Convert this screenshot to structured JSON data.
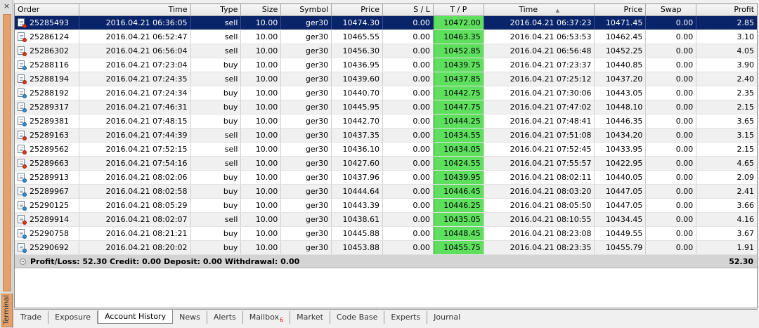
{
  "window": {
    "sidebar_label": "Terminal",
    "close_glyph": "×"
  },
  "columns": {
    "order": "Order",
    "time": "Time",
    "type": "Type",
    "size": "Size",
    "symbol": "Symbol",
    "price": "Price",
    "sl": "S / L",
    "tp": "T / P",
    "close_time": "Time",
    "sort_indicator": "▲",
    "close_price": "Price",
    "swap": "Swap",
    "profit": "Profit"
  },
  "colors": {
    "sell_dot": "#d9391c",
    "buy_dot": "#2d8fd9",
    "tp_highlight": "#5ee05e",
    "selected_row": "#0a246a"
  },
  "rows": [
    {
      "order": "25285493",
      "time": "2016.04.21 06:36:05",
      "type": "sell",
      "size": "10.00",
      "symbol": "ger30",
      "price": "10474.30",
      "sl": "0.00",
      "tp": "10472.00",
      "close_time": "2016.04.21 06:37:23",
      "close_price": "10471.45",
      "swap": "0.00",
      "profit": "2.85"
    },
    {
      "order": "25286124",
      "time": "2016.04.21 06:52:47",
      "type": "sell",
      "size": "10.00",
      "symbol": "ger30",
      "price": "10465.55",
      "sl": "0.00",
      "tp": "10463.35",
      "close_time": "2016.04.21 06:53:53",
      "close_price": "10462.45",
      "swap": "0.00",
      "profit": "3.10"
    },
    {
      "order": "25286302",
      "time": "2016.04.21 06:56:04",
      "type": "sell",
      "size": "10.00",
      "symbol": "ger30",
      "price": "10456.30",
      "sl": "0.00",
      "tp": "10452.85",
      "close_time": "2016.04.21 06:56:48",
      "close_price": "10452.25",
      "swap": "0.00",
      "profit": "4.05"
    },
    {
      "order": "25288116",
      "time": "2016.04.21 07:23:04",
      "type": "buy",
      "size": "10.00",
      "symbol": "ger30",
      "price": "10436.95",
      "sl": "0.00",
      "tp": "10439.75",
      "close_time": "2016.04.21 07:23:37",
      "close_price": "10440.85",
      "swap": "0.00",
      "profit": "3.90"
    },
    {
      "order": "25288194",
      "time": "2016.04.21 07:24:35",
      "type": "sell",
      "size": "10.00",
      "symbol": "ger30",
      "price": "10439.60",
      "sl": "0.00",
      "tp": "10437.85",
      "close_time": "2016.04.21 07:25:12",
      "close_price": "10437.20",
      "swap": "0.00",
      "profit": "2.40"
    },
    {
      "order": "25288192",
      "time": "2016.04.21 07:24:34",
      "type": "buy",
      "size": "10.00",
      "symbol": "ger30",
      "price": "10440.70",
      "sl": "0.00",
      "tp": "10442.75",
      "close_time": "2016.04.21 07:30:06",
      "close_price": "10443.05",
      "swap": "0.00",
      "profit": "2.35"
    },
    {
      "order": "25289317",
      "time": "2016.04.21 07:46:31",
      "type": "buy",
      "size": "10.00",
      "symbol": "ger30",
      "price": "10445.95",
      "sl": "0.00",
      "tp": "10447.75",
      "close_time": "2016.04.21 07:47:02",
      "close_price": "10448.10",
      "swap": "0.00",
      "profit": "2.15"
    },
    {
      "order": "25289381",
      "time": "2016.04.21 07:48:15",
      "type": "buy",
      "size": "10.00",
      "symbol": "ger30",
      "price": "10442.70",
      "sl": "0.00",
      "tp": "10444.25",
      "close_time": "2016.04.21 07:48:41",
      "close_price": "10446.35",
      "swap": "0.00",
      "profit": "3.65"
    },
    {
      "order": "25289163",
      "time": "2016.04.21 07:44:39",
      "type": "sell",
      "size": "10.00",
      "symbol": "ger30",
      "price": "10437.35",
      "sl": "0.00",
      "tp": "10434.55",
      "close_time": "2016.04.21 07:51:08",
      "close_price": "10434.20",
      "swap": "0.00",
      "profit": "3.15"
    },
    {
      "order": "25289562",
      "time": "2016.04.21 07:52:15",
      "type": "sell",
      "size": "10.00",
      "symbol": "ger30",
      "price": "10436.10",
      "sl": "0.00",
      "tp": "10434.05",
      "close_time": "2016.04.21 07:52:45",
      "close_price": "10433.95",
      "swap": "0.00",
      "profit": "2.15"
    },
    {
      "order": "25289663",
      "time": "2016.04.21 07:54:16",
      "type": "sell",
      "size": "10.00",
      "symbol": "ger30",
      "price": "10427.60",
      "sl": "0.00",
      "tp": "10424.55",
      "close_time": "2016.04.21 07:55:57",
      "close_price": "10422.95",
      "swap": "0.00",
      "profit": "4.65"
    },
    {
      "order": "25289913",
      "time": "2016.04.21 08:02:06",
      "type": "buy",
      "size": "10.00",
      "symbol": "ger30",
      "price": "10437.96",
      "sl": "0.00",
      "tp": "10439.95",
      "close_time": "2016.04.21 08:02:11",
      "close_price": "10440.05",
      "swap": "0.00",
      "profit": "2.09"
    },
    {
      "order": "25289967",
      "time": "2016.04.21 08:02:58",
      "type": "buy",
      "size": "10.00",
      "symbol": "ger30",
      "price": "10444.64",
      "sl": "0.00",
      "tp": "10446.45",
      "close_time": "2016.04.21 08:03:20",
      "close_price": "10447.05",
      "swap": "0.00",
      "profit": "2.41"
    },
    {
      "order": "25290125",
      "time": "2016.04.21 08:05:29",
      "type": "buy",
      "size": "10.00",
      "symbol": "ger30",
      "price": "10443.39",
      "sl": "0.00",
      "tp": "10446.25",
      "close_time": "2016.04.21 08:05:50",
      "close_price": "10447.05",
      "swap": "0.00",
      "profit": "3.66"
    },
    {
      "order": "25289914",
      "time": "2016.04.21 08:02:07",
      "type": "sell",
      "size": "10.00",
      "symbol": "ger30",
      "price": "10438.61",
      "sl": "0.00",
      "tp": "10435.05",
      "close_time": "2016.04.21 08:10:55",
      "close_price": "10434.45",
      "swap": "0.00",
      "profit": "4.16"
    },
    {
      "order": "25290758",
      "time": "2016.04.21 08:21:21",
      "type": "buy",
      "size": "10.00",
      "symbol": "ger30",
      "price": "10445.88",
      "sl": "0.00",
      "tp": "10448.45",
      "close_time": "2016.04.21 08:23:08",
      "close_price": "10449.55",
      "swap": "0.00",
      "profit": "3.67"
    },
    {
      "order": "25290692",
      "time": "2016.04.21 08:20:02",
      "type": "buy",
      "size": "10.00",
      "symbol": "ger30",
      "price": "10453.88",
      "sl": "0.00",
      "tp": "10455.75",
      "close_time": "2016.04.21 08:23:35",
      "close_price": "10455.79",
      "swap": "0.00",
      "profit": "1.91"
    }
  ],
  "summary": {
    "text": "Profit/Loss: 52.30  Credit: 0.00  Deposit: 0.00  Withdrawal: 0.00",
    "total_profit": "52.30"
  },
  "tabs": [
    {
      "label": "Trade",
      "active": false
    },
    {
      "label": "Exposure",
      "active": false
    },
    {
      "label": "Account History",
      "active": true
    },
    {
      "label": "News",
      "active": false
    },
    {
      "label": "Alerts",
      "active": false
    },
    {
      "label": "Mailbox",
      "active": false,
      "badge": "6"
    },
    {
      "label": "Market",
      "active": false
    },
    {
      "label": "Code Base",
      "active": false
    },
    {
      "label": "Experts",
      "active": false
    },
    {
      "label": "Journal",
      "active": false
    }
  ]
}
